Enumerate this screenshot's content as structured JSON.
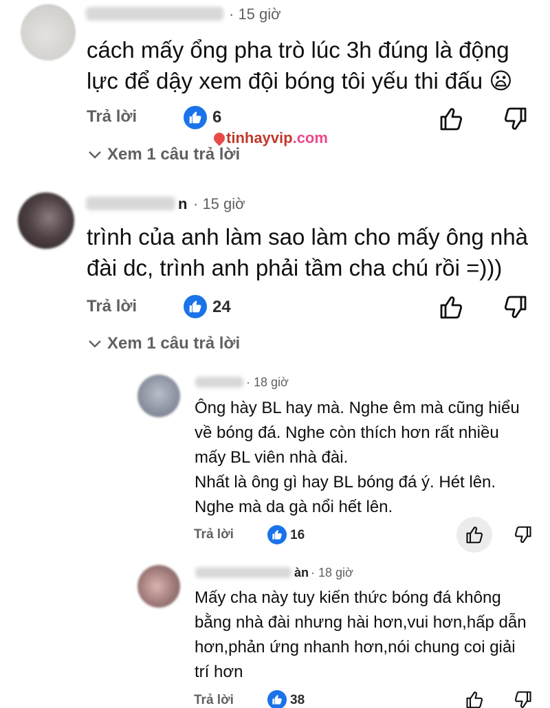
{
  "watermark": {
    "brand": "tinhayvip",
    "tld": ".com"
  },
  "ui": {
    "reply_label": "Trả lời"
  },
  "comments": [
    {
      "time": "· 15 giờ",
      "text_lines": [
        "cách mấy ổng pha trò lúc 3h đúng là động",
        "lực để dậy xem đội bóng tôi yếu thi đấu 😦"
      ],
      "likes": "6",
      "see_replies": "Xem 1 câu trả lời"
    },
    {
      "name_tail": "n",
      "time": "· 15 giờ",
      "text_lines": [
        "trình của anh làm sao làm cho mấy ông nhà",
        "đài dc, trình anh phải tầm cha chú rồi =)))"
      ],
      "likes": "24",
      "see_replies": "Xem 1 câu trả lời"
    }
  ],
  "replies": [
    {
      "time": "· 18 giờ",
      "text_lines": [
        "Ông hày BL hay mà. Nghe êm mà cũng hiểu",
        "về bóng đá. Nghe còn thích hơn rất nhiều",
        "mấy BL viên nhà đài.",
        "Nhất là ông gì hay BL bóng đá ý. Hét lên.",
        "Nghe mà da gà nổi hết lên."
      ],
      "likes": "16"
    },
    {
      "name_tail": "àn",
      "time": "· 18 giờ",
      "text_lines": [
        "Mấy cha này tuy kiến thức bóng đá không",
        "bằng nhà đài nhưng hài hơn,vui hơn,hấp dẫn",
        "hơn,phản ứng nhanh hơn,nói chung coi giải",
        "trí hơn"
      ],
      "likes": "38"
    }
  ],
  "icons": {
    "like_badge": "thumbs-up-icon",
    "like_button": "thumbs-up-outline-icon",
    "dislike_button": "thumbs-down-outline-icon",
    "expand": "chevron-down-icon"
  },
  "colors": {
    "like_badge": "#1a73e8",
    "meta": "#606060",
    "text": "#0f0f0f"
  }
}
